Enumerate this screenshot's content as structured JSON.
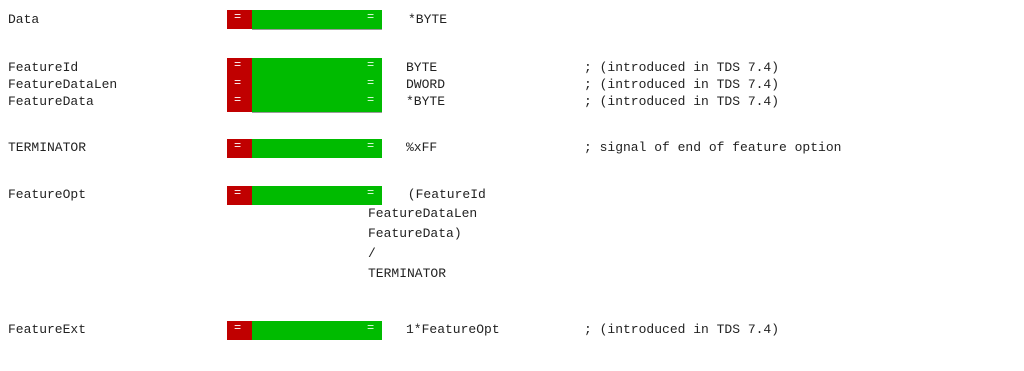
{
  "diff_marker": {
    "removed_glyph": "=",
    "added_glyph": "=",
    "removed_color": "#c00000",
    "added_color": "#00bb00"
  },
  "rows": [
    {
      "name": "Data",
      "type": "*BYTE",
      "comment": ""
    },
    {
      "name": "FeatureId",
      "type": "BYTE",
      "comment": "; (introduced in TDS 7.4)"
    },
    {
      "name": "FeatureDataLen",
      "type": "DWORD",
      "comment": "; (introduced in TDS 7.4)"
    },
    {
      "name": "FeatureData",
      "type": "*BYTE",
      "comment": "; (introduced in TDS 7.4)"
    },
    {
      "name": "TERMINATOR",
      "type": "%xFF",
      "comment": "; signal of end of feature option"
    },
    {
      "name": "FeatureOpt",
      "type": " (FeatureId",
      "comment": ""
    },
    {
      "name": "FeatureExt",
      "type": "1*FeatureOpt",
      "comment": "; (introduced in TDS 7.4)"
    }
  ],
  "feature_opt_continuation": [
    "FeatureDataLen",
    "FeatureData)",
    "/",
    "TERMINATOR"
  ]
}
